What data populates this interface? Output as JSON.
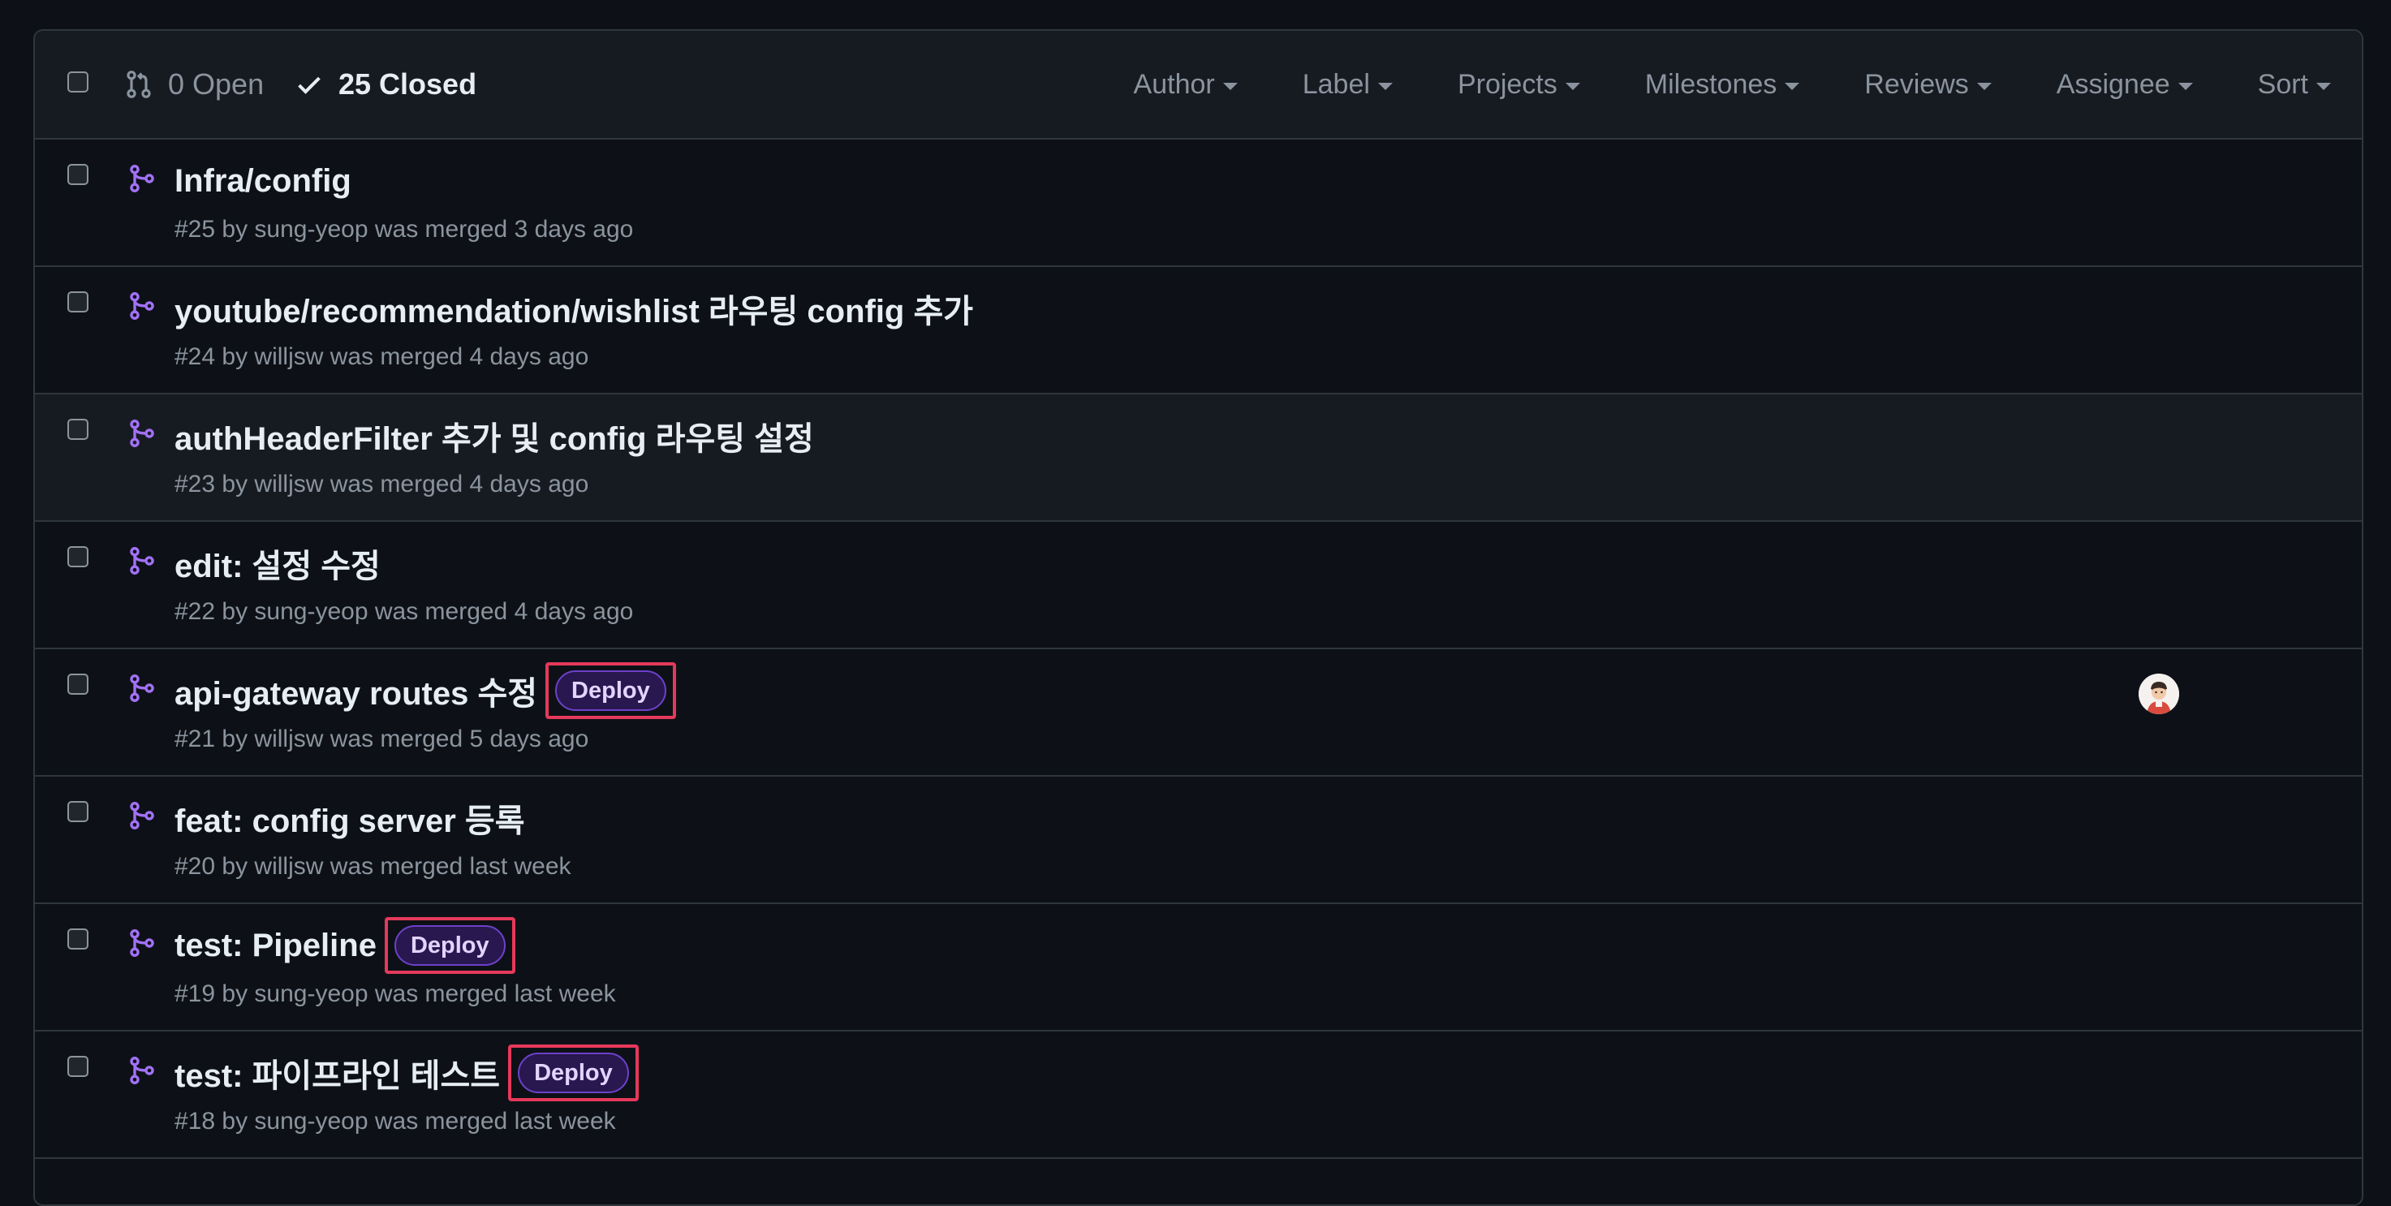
{
  "header": {
    "open_label": "0 Open",
    "closed_label": "25 Closed",
    "filters": [
      "Author",
      "Label",
      "Projects",
      "Milestones",
      "Reviews",
      "Assignee",
      "Sort"
    ]
  },
  "colors": {
    "merged_icon": "#a371f7",
    "label_deploy_bg": "#28184f",
    "highlight_box": "#e5395b"
  },
  "pull_requests": [
    {
      "title": "Infra/config",
      "meta": "#25 by sung-yeop was merged 3 days ago"
    },
    {
      "title": "youtube/recommendation/wishlist 라우팅 config 추가",
      "meta": "#24 by willjsw was merged 4 days ago"
    },
    {
      "title": "authHeaderFilter 추가 및 config 라우팅 설정",
      "meta": "#23 by willjsw was merged 4 days ago"
    },
    {
      "title": "edit: 설정 수정",
      "meta": "#22 by sung-yeop was merged 4 days ago"
    },
    {
      "title": "api-gateway routes 수정",
      "label": "Deploy",
      "meta": "#21 by willjsw was merged 5 days ago"
    },
    {
      "title": "feat: config server 등록",
      "meta": "#20 by willjsw was merged last week"
    },
    {
      "title": "test: Pipeline",
      "label": "Deploy",
      "meta": "#19 by sung-yeop was merged last week"
    },
    {
      "title": "test: 파이프라인 테스트",
      "label": "Deploy",
      "meta": "#18 by sung-yeop was merged last week"
    }
  ]
}
